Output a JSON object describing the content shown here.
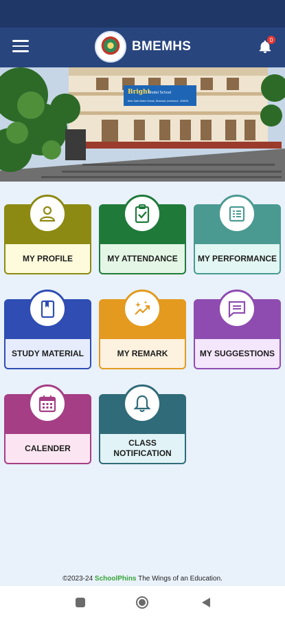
{
  "app": {
    "title": "BMEMHS",
    "notification_count": "0"
  },
  "banner": {
    "school_sign": "Bright",
    "school_sign_sub": "Model School",
    "school_sign_line": "Near Gate Kodhe Chowk, Dhanbad, Jharkhand - 826001"
  },
  "tiles": [
    {
      "label": "MY PROFILE",
      "icon": "person-icon",
      "color": "#8c8a12",
      "light": "#fdfbdc"
    },
    {
      "label": "MY ATTENDANCE",
      "icon": "clipboard-check-icon",
      "color": "#1f7a3a",
      "light": "#e4f6e6"
    },
    {
      "label": "MY PERFORMANCE",
      "icon": "list-chart-icon",
      "color": "#4a9a92",
      "light": "#e2f6f3"
    },
    {
      "label": "STUDY MATERIAL",
      "icon": "book-icon",
      "color": "#2f4db2",
      "light": "#e6ecfb"
    },
    {
      "label": "MY REMARK",
      "icon": "sparkle-trend-icon",
      "color": "#e39a1e",
      "light": "#fdf1df"
    },
    {
      "label": "MY SUGGESTIONS",
      "icon": "chat-lines-icon",
      "color": "#8e4cb0",
      "light": "#f4e6fb"
    },
    {
      "label": "CALENDER",
      "icon": "calendar-icon",
      "color": "#a53e84",
      "light": "#fbe5f2"
    },
    {
      "label": "CLASS NOTIFICATION",
      "icon": "bell-icon",
      "color": "#2f6b78",
      "light": "#e1f3f6"
    }
  ],
  "footer": {
    "prefix": "©2023-24 ",
    "brand": "SchoolPhins",
    "suffix": " The Wings of an Education."
  }
}
